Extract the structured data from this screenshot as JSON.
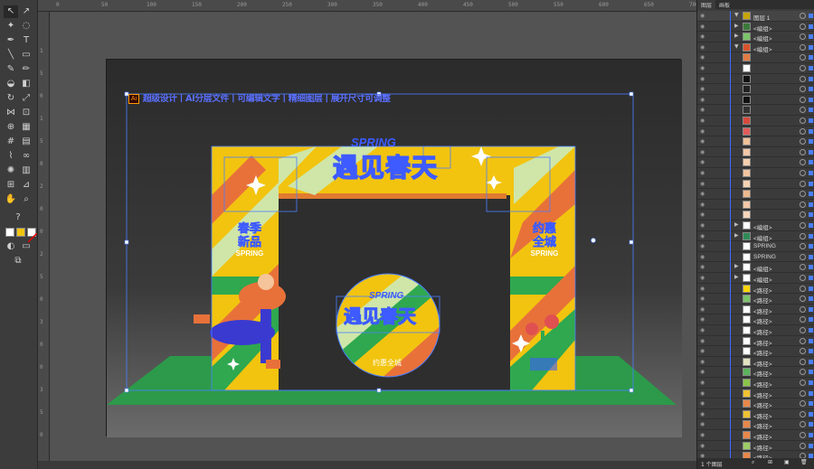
{
  "ruler_top": [
    "0",
    "50",
    "100",
    "150",
    "200",
    "250",
    "300",
    "350",
    "400",
    "450",
    "500",
    "550",
    "600",
    "650",
    "700"
  ],
  "ruler_left": [
    "1",
    "5",
    "0",
    "1",
    "5",
    "0",
    "2",
    "0",
    "0",
    "2",
    "5",
    "0",
    "3",
    "0",
    "0",
    "3",
    "5",
    "0"
  ],
  "layers_panel": {
    "tab_layers": "图层",
    "tab_artboards": "画板",
    "rows": [
      {
        "name": "图层 1",
        "thumb": "#c6a400",
        "top": true,
        "tri": "▼"
      },
      {
        "name": "<编组>",
        "thumb": "#3b7a3b",
        "tri": "▶"
      },
      {
        "name": "<编组>",
        "thumb": "#7cc36a",
        "tri": "▶"
      },
      {
        "name": "<编组>",
        "thumb": "#d9542b",
        "tri": "▼"
      },
      {
        "name": "",
        "thumb": "#e37b43"
      },
      {
        "name": "",
        "thumb": "#ffffff"
      },
      {
        "name": "",
        "thumb": "#111111"
      },
      {
        "name": "",
        "thumb": "#222222"
      },
      {
        "name": "",
        "thumb": "#111111"
      },
      {
        "name": "",
        "thumb": "#333333"
      },
      {
        "name": "",
        "thumb": "#d94a3c"
      },
      {
        "name": "",
        "thumb": "#e25c5c"
      },
      {
        "name": "",
        "thumb": "#f0c29a"
      },
      {
        "name": "",
        "thumb": "#f2c8a8"
      },
      {
        "name": "",
        "thumb": "#f4d0b0"
      },
      {
        "name": "",
        "thumb": "#f1c4a0"
      },
      {
        "name": "",
        "thumb": "#f5d3b4"
      },
      {
        "name": "",
        "thumb": "#eeb98e"
      },
      {
        "name": "",
        "thumb": "#f2c8a8"
      },
      {
        "name": "",
        "thumb": "#f6d7bc"
      },
      {
        "name": "<编组>",
        "thumb": "#ffffff",
        "tri": "▶"
      },
      {
        "name": "<编组>",
        "thumb": "#2e8b57",
        "tri": "▶"
      },
      {
        "name": "SPRING",
        "thumb": "#ffffff"
      },
      {
        "name": "SPRING",
        "thumb": "#ffffff"
      },
      {
        "name": "<编组>",
        "thumb": "#ffffff",
        "tri": "▶"
      },
      {
        "name": "<编组>",
        "thumb": "#ffffff",
        "tri": "▶"
      },
      {
        "name": "<路径>",
        "thumb": "#ffd400"
      },
      {
        "name": "<路径>",
        "thumb": "#7cc36a"
      },
      {
        "name": "<路径>",
        "thumb": "#ffffff"
      },
      {
        "name": "<路径>",
        "thumb": "#ffffff"
      },
      {
        "name": "<路径>",
        "thumb": "#ffffff"
      },
      {
        "name": "<路径>",
        "thumb": "#ffffff"
      },
      {
        "name": "<路径>",
        "thumb": "#ffffff"
      },
      {
        "name": "<路径>",
        "thumb": "#e2e2c0"
      },
      {
        "name": "<路径>",
        "thumb": "#5bb35b"
      },
      {
        "name": "<路径>",
        "thumb": "#8bc34a"
      },
      {
        "name": "<路径>",
        "thumb": "#f1c232"
      },
      {
        "name": "<路径>",
        "thumb": "#e8874a"
      },
      {
        "name": "<路径>",
        "thumb": "#f1c232"
      },
      {
        "name": "<路径>",
        "thumb": "#e8874a"
      },
      {
        "name": "<路径>",
        "thumb": "#e8874a"
      },
      {
        "name": "<路径>",
        "thumb": "#9ccc65"
      },
      {
        "name": "<路径>",
        "thumb": "#e8874a"
      }
    ],
    "footer": "1 个图层"
  },
  "artwork": {
    "top_bar_text": "超级设计丨AI分层文件丨可编辑文字丨精细图层丨展开尺寸可调整",
    "ai_badge": "Ai",
    "arch_spring": "SPRING",
    "arch_title": "遇见春天",
    "left_label_line1": "春季",
    "left_label_line2": "新品",
    "left_spring": "SPRING",
    "right_label_line1": "约惠",
    "right_label_line2": "全城",
    "right_spring": "SPRING",
    "circle_spring": "SPRING",
    "circle_title": "遇见春天",
    "circle_sub": "约惠全城"
  },
  "colors": {
    "arch_yellow": "#f2c40f",
    "arch_orange": "#e8713a",
    "arch_green": "#2fa84f",
    "light_green": "#cfe6a8",
    "text_blue": "#3d5bff",
    "floor_green": "#2c9a4a",
    "selection": "#4a7fff"
  }
}
